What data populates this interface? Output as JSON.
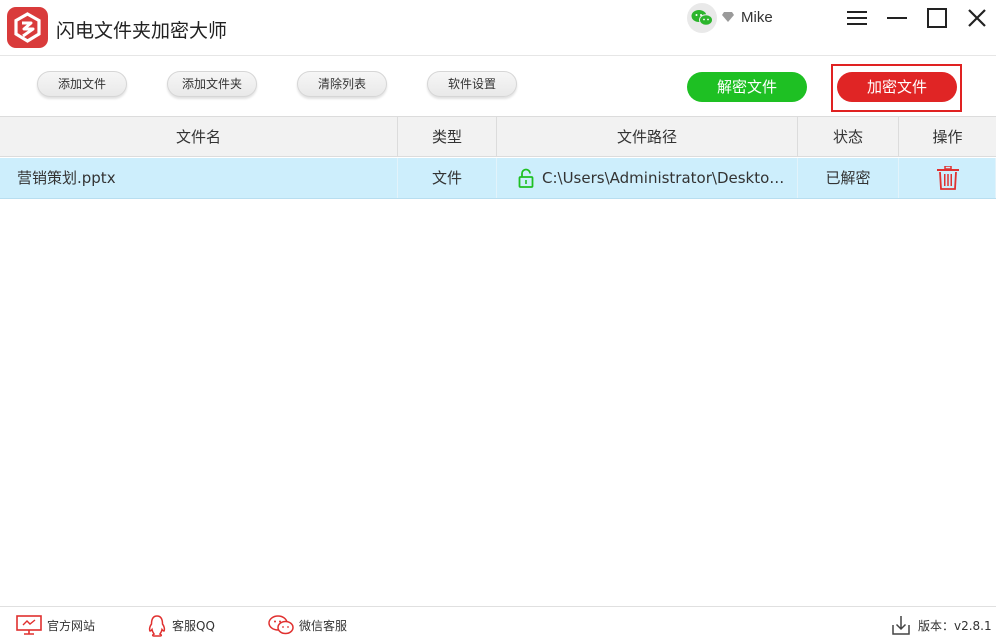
{
  "app": {
    "title": "闪电文件夹加密大师",
    "user_name": "Mike"
  },
  "toolbar": {
    "add_file": "添加文件",
    "add_folder": "添加文件夹",
    "clear_list": "清除列表",
    "settings": "软件设置",
    "decrypt": "解密文件",
    "encrypt": "加密文件"
  },
  "table": {
    "columns": {
      "name": "文件名",
      "type": "类型",
      "path": "文件路径",
      "status": "状态",
      "action": "操作"
    },
    "rows": [
      {
        "name": "营销策划.pptx",
        "type": "文件",
        "path": "C:\\Users\\Administrator\\Desktop\\营销策划.pptx",
        "status": "已解密"
      }
    ]
  },
  "footer": {
    "website": "官方网站",
    "qq": "客服QQ",
    "wechat": "微信客服",
    "version": "版本：v2.8.1"
  },
  "colors": {
    "brand": "#d93b3b",
    "decrypt": "#1ec023",
    "encrypt": "#e02525",
    "row_selected": "#cdeefc"
  },
  "icons": {
    "logo": "app-logo-icon",
    "wechat": "wechat-icon",
    "vip": "diamond-icon",
    "lock": "unlock-icon",
    "delete": "trash-icon",
    "website": "monitor-icon",
    "qq": "qq-penguin-icon",
    "wechat_support": "wechat-chat-icon",
    "download": "download-icon"
  }
}
